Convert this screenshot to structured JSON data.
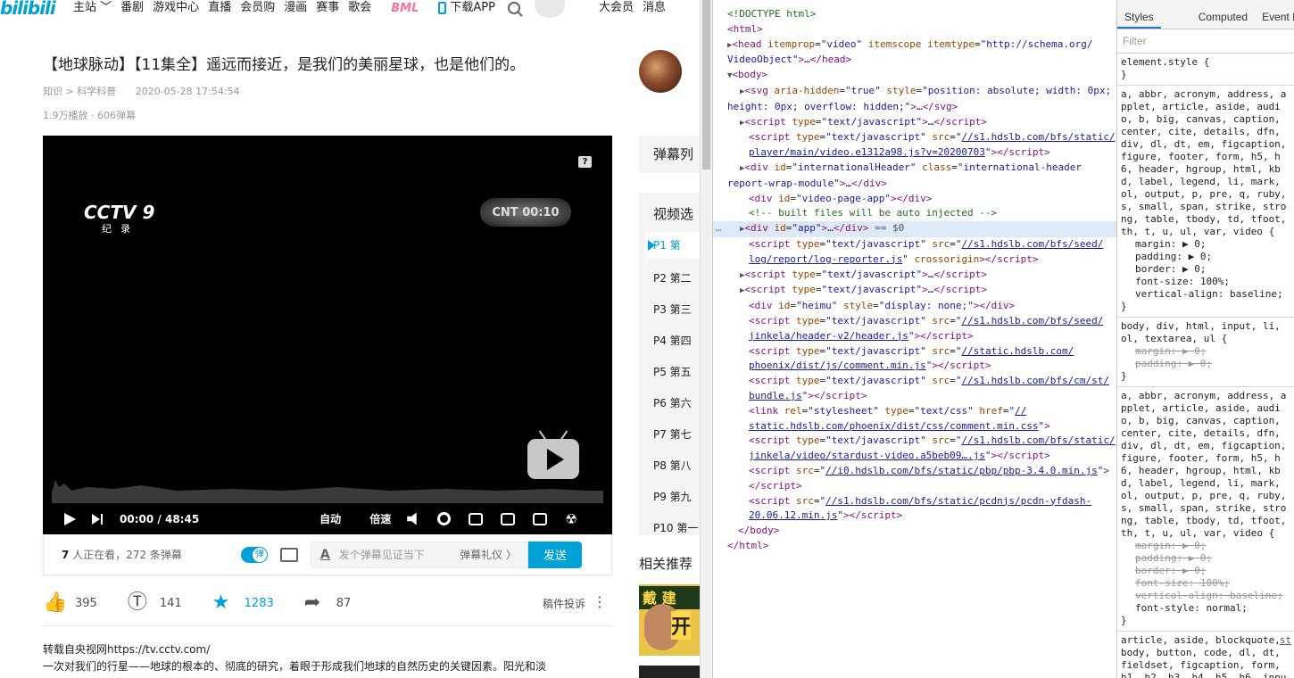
{
  "site": {
    "logo": "bilibili",
    "nav": [
      "主站",
      "番剧",
      "游戏中心",
      "直播",
      "会员购",
      "漫画",
      "赛事",
      "歌会"
    ],
    "bml": "BML",
    "download": "下载APP",
    "nav_right": [
      "大会员",
      "消息"
    ],
    "video_title": "【地球脉动】【11集全】遥远而接近，是我们的美丽星球，也是他们的。",
    "category": "知识 > 科学科普",
    "pubdate": "2020-05-28 17:54:54",
    "stats": "1.9万播放 · 606弹幕",
    "player": {
      "channel_logo": "CCTV 9",
      "channel_sub": "纪录",
      "cn_logo": "CNT 00:10",
      "help": "?",
      "current_time": "00:00",
      "separator": "/",
      "duration": "48:45",
      "auto": "自动",
      "speed": "倍速"
    },
    "danmaku_bar": {
      "viewers": "7",
      "viewers_text": " 人正在看，",
      "count": "272",
      "count_text": " 条弹幕",
      "placeholder": "发个弹幕见证当下",
      "etiquette": "弹幕礼仪 〉",
      "send": "发送"
    },
    "actions": {
      "like": "395",
      "coin": "141",
      "fav": "1283",
      "share": "87",
      "report": "稿件投诉"
    },
    "description": [
      "转载自央视网https://tv.cctv.com/",
      "一次对我们的行星——地球的根本的、彻底的研究，着眼于形成我们地球的自然历史的关键因素。阳光和淡"
    ],
    "sidebar": {
      "danmaku_list": "弹幕列",
      "video_select": "视频选",
      "episodes": [
        "P1 第",
        "P2 第二",
        "P3 第三",
        "P4 第四",
        "P5 第五",
        "P6 第六",
        "P7 第七",
        "P8 第八",
        "P9 第九",
        "P10 第一"
      ],
      "related": "相关推荐",
      "rel_thumb_top": "戴 建",
      "rel_thumb_mid": "开"
    }
  },
  "devtools": {
    "styles_tabs": [
      "Styles",
      "Computed",
      "Event Listen"
    ],
    "filter_placeholder": "Filter",
    "element_style": "element.style {",
    "close_brace": "}",
    "rule1_selector": "a, abbr, acronym, address, applet, article, aside, audio, b, big, canvas, caption, center, cite, details, dfn, div, dl, dt, em, figcaption, figure, footer, form, h5, h6, header, hgroup, html, kbd, label, legend, li, mark, ol, output, p, pre, q, ruby, s, small, span, strike, strong, table, tbody, td, tfoot, th, t, u, ul, var, video {",
    "rule1_props": [
      "margin: ▶ 0;",
      "padding: ▶ 0;",
      "border: ▶ 0;",
      "font-size: 100%;",
      "vertical-align: baseline;"
    ],
    "rule2_selector": "body, div, html, input, li, ol, textarea, ul {",
    "rule2_props": [
      "margin: ▶ 0;",
      "padding: ▶ 0;"
    ],
    "rule3_selector": "a, abbr, acronym, address, applet, article, aside, audio, b, big, canvas, caption, center, cite, details, dfn, div, dl, dt, em, figcaption, figure, footer, form, h5, h6, header, hgroup, html, kbd, label, legend, li, mark, ol, output, p, pre, q, ruby, s, small, span, strike, strong, table, tbody, td, tfoot, th, t, u, ul, var, video {",
    "rule3_props_struck": [
      "margin: ▶ 0;",
      "padding: ▶ 0;",
      "border: ▶ 0;",
      "font-size: 100%;",
      "vertical-align: baseline;"
    ],
    "rule3_prop_active": "font-style: normal;",
    "rule4_selector": "article, aside, blockquote, body, button, code, dl, dt, fieldset, figcaption, form, h1, h2, h3, h4, h5, h6, input, legend, li, menu, nav,",
    "rule4_source": "st",
    "selected_suffix": " == $0",
    "dots": "…"
  },
  "colors": {
    "bili_blue": "#00a1d6",
    "bml_pink": "#fb7299",
    "devtools_selected": "#dee9f8"
  }
}
